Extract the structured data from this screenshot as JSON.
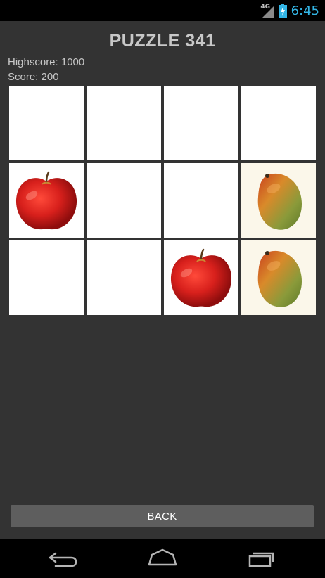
{
  "status_bar": {
    "network": "4G",
    "time": "6:45",
    "time_color": "#33b5e5"
  },
  "header": {
    "title": "PUZZLE 341",
    "highscore": "Highscore: 1000",
    "score": "Score: 200"
  },
  "grid": {
    "rows": 3,
    "columns": 4,
    "cells": [
      [
        "empty",
        "empty",
        "empty",
        "empty"
      ],
      [
        "apple",
        "empty",
        "empty",
        "mango"
      ],
      [
        "empty",
        "empty",
        "apple",
        "mango"
      ]
    ]
  },
  "buttons": {
    "back": "BACK"
  },
  "nav_bar": {
    "icons": [
      "back-icon",
      "home-icon",
      "recent-apps-icon"
    ]
  }
}
